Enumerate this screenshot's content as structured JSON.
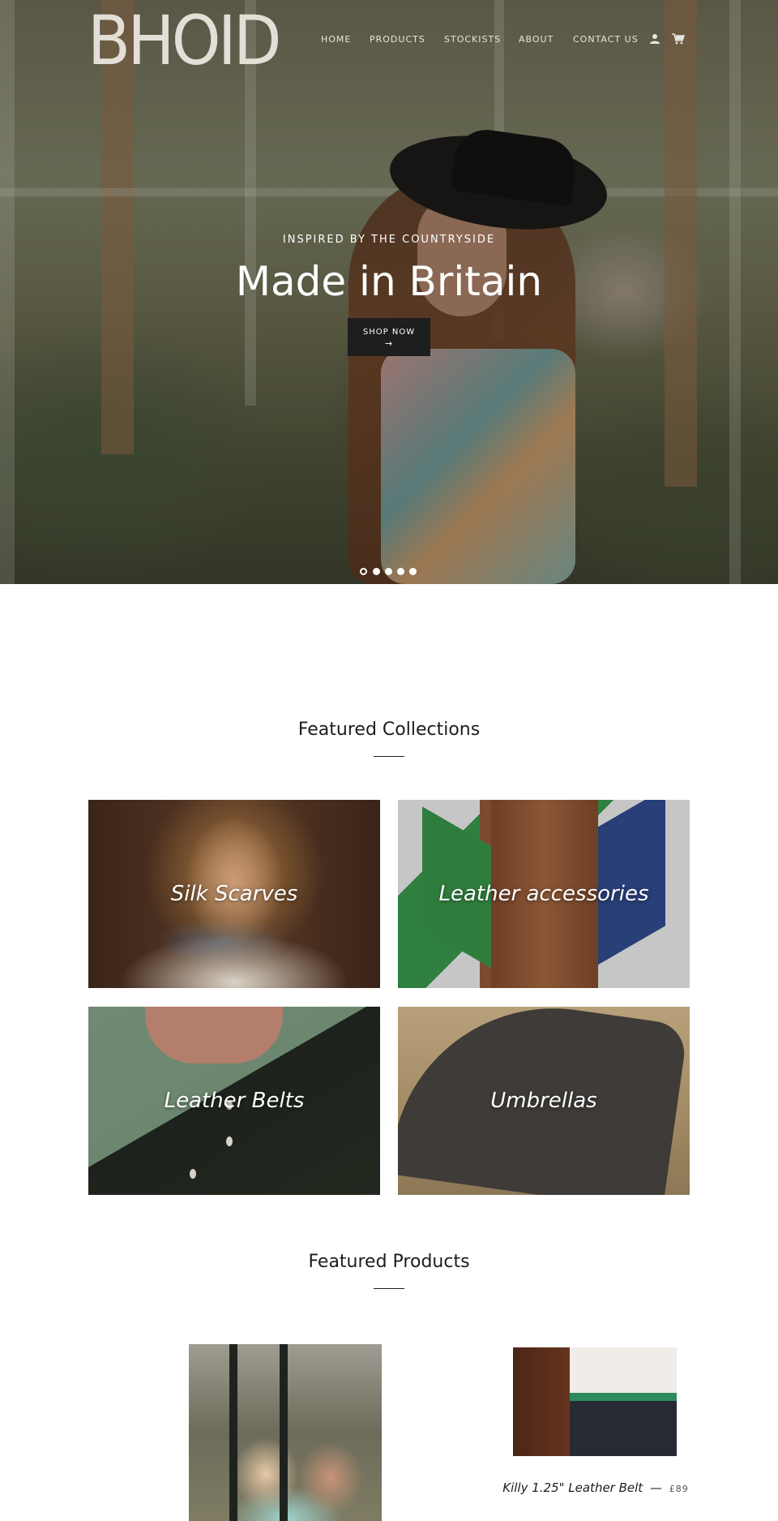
{
  "brand": {
    "logo_text": "BHOID"
  },
  "nav": {
    "items": [
      "HOME",
      "PRODUCTS",
      "STOCKISTS",
      "ABOUT",
      "CONTACT US"
    ],
    "account_icon": "user-icon",
    "cart_icon": "cart-icon"
  },
  "hero": {
    "subtitle": "INSPIRED BY THE COUNTRYSIDE",
    "title": "Made in Britain",
    "button_label": "SHOP NOW",
    "button_arrow": "→",
    "slides_total": 5,
    "active_slide": 1
  },
  "featured_collections": {
    "title": "Featured Collections",
    "items": [
      {
        "label": "Silk Scarves"
      },
      {
        "label": "Leather accessories"
      },
      {
        "label": "Leather Belts"
      },
      {
        "label": "Umbrellas"
      }
    ]
  },
  "featured_products": {
    "title": "Featured Products",
    "items": [
      {
        "name": "",
        "price": ""
      },
      {
        "name": "Killy 1.25\" Leather Belt",
        "separator": "—",
        "price": "£89"
      }
    ]
  },
  "colors": {
    "text": "#1c1d1d",
    "button_bg": "#1d1e1e",
    "hero_text": "#ffffff"
  }
}
